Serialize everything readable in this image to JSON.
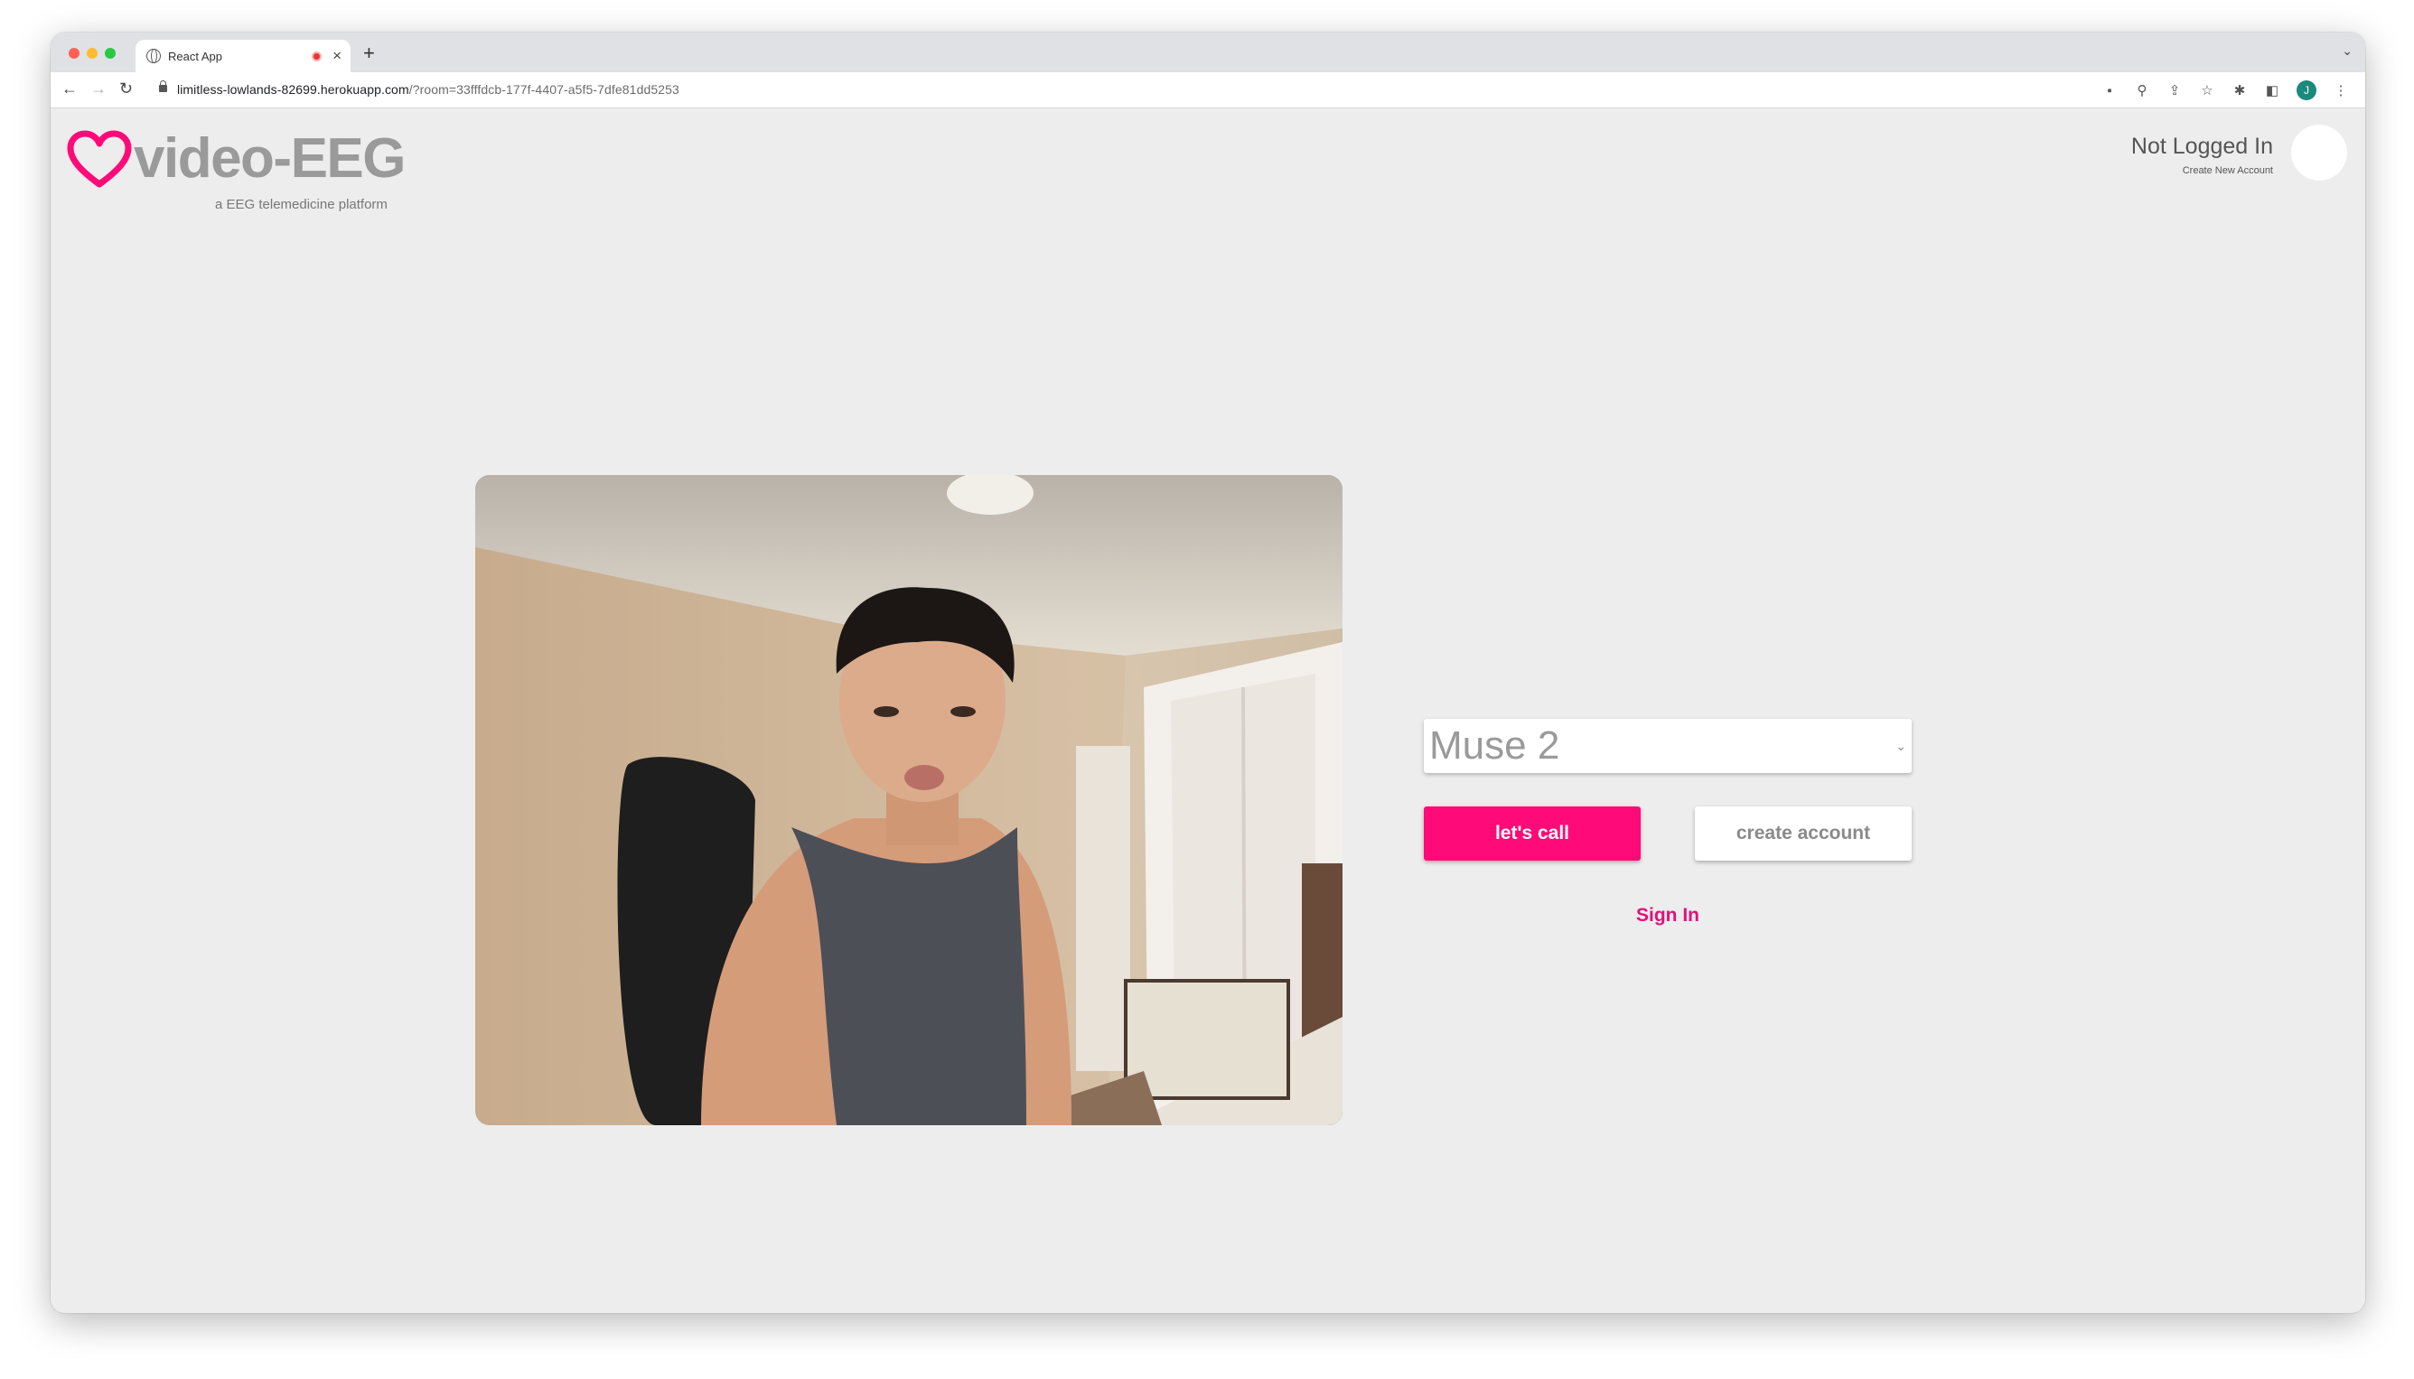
{
  "browser": {
    "tab_title": "React App",
    "url_host": "limitless-lowlands-82699.herokuapp.com",
    "url_path": "/?room=33fffdcb-177f-4407-a5f5-7dfe81dd5253",
    "profile_initial": "J"
  },
  "header": {
    "logo_text": "video-EEG",
    "tagline": "a EEG telemedicine platform",
    "account_status": "Not Logged In",
    "create_account_link": "Create New Account"
  },
  "device_select": {
    "selected": "Muse 2"
  },
  "actions": {
    "call_label": "let's call",
    "create_label": "create account",
    "signin_label": "Sign In"
  },
  "colors": {
    "accent": "#ff0a78",
    "page_bg": "#ededed",
    "logo_gray": "#9a9a9a"
  }
}
